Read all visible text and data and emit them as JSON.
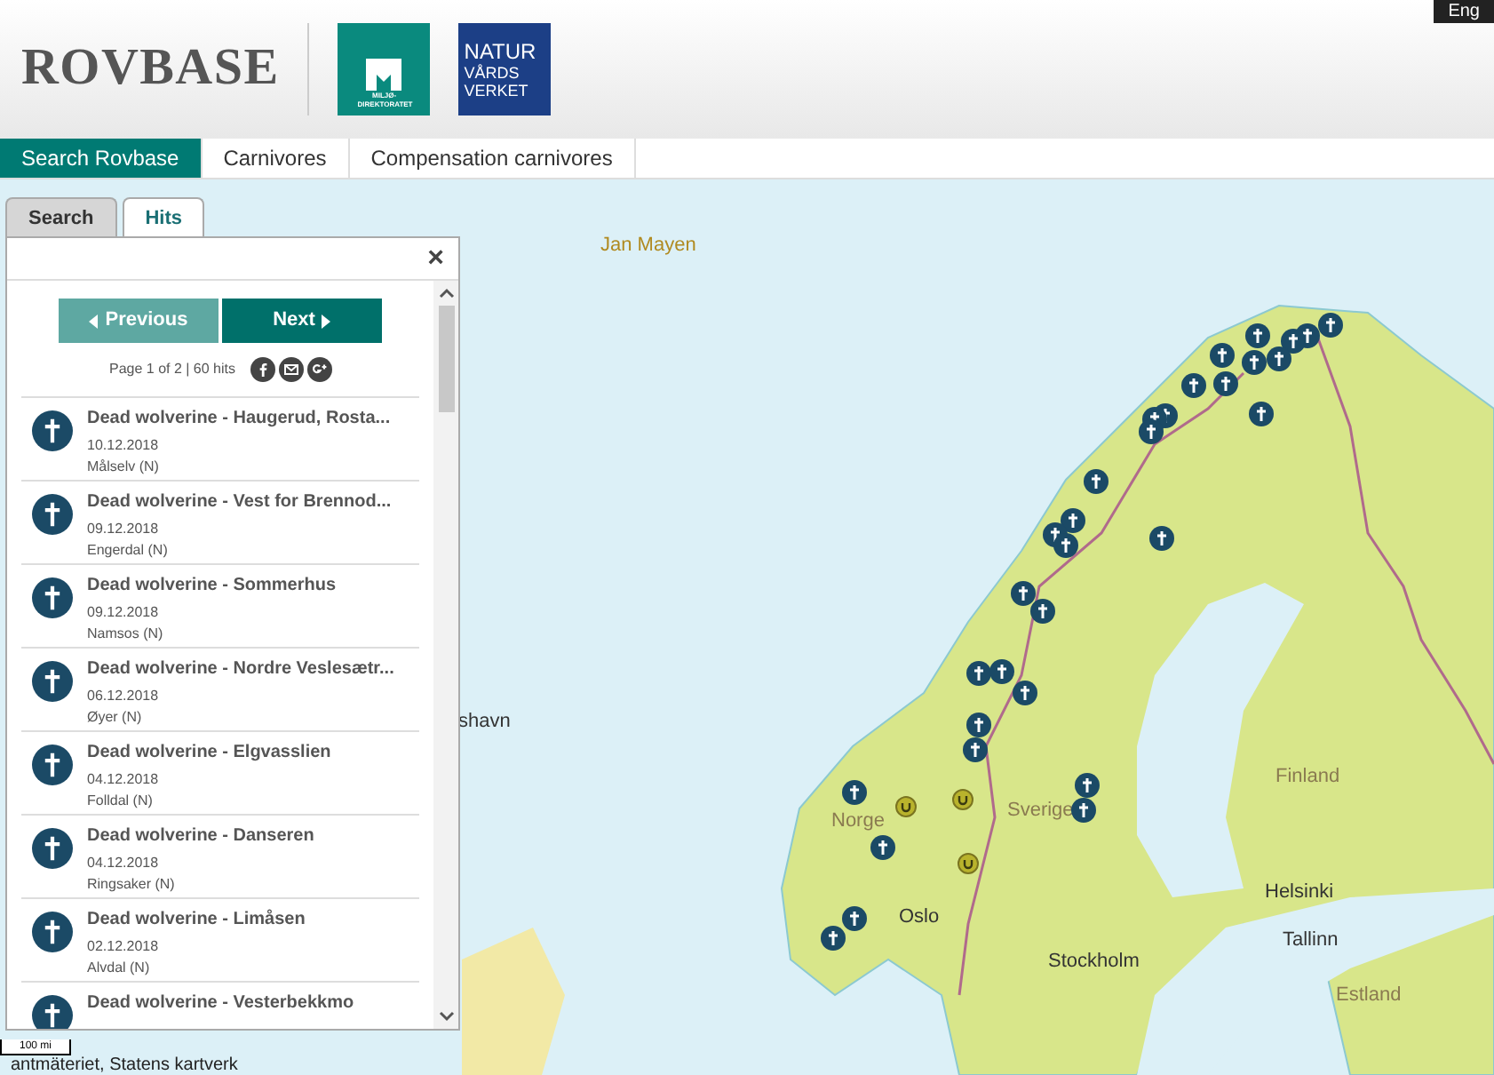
{
  "header": {
    "logo": "ROVBASE",
    "agency_logo_1": "MILJØ-DIREKTORATET",
    "agency_logo_2": [
      "NATUR",
      "VÅRDS",
      "VERKET"
    ],
    "language_button": "Eng"
  },
  "nav": [
    {
      "label": "Search Rovbase",
      "selected": true
    },
    {
      "label": "Carnivores",
      "selected": false
    },
    {
      "label": "Compensation carnivores",
      "selected": false
    }
  ],
  "panel_tabs": [
    {
      "label": "Search",
      "selected": false
    },
    {
      "label": "Hits",
      "selected": true
    }
  ],
  "panel": {
    "close": "×",
    "previous": "Previous",
    "next": "Next",
    "paging": "Page 1 of 2 | 60 hits",
    "hits": [
      {
        "title": "Dead wolverine - Haugerud, Rosta...",
        "date": "10.12.2018",
        "place": "Målselv (N)"
      },
      {
        "title": "Dead wolverine - Vest for Brennod...",
        "date": "09.12.2018",
        "place": "Engerdal (N)"
      },
      {
        "title": "Dead wolverine - Sommerhus",
        "date": "09.12.2018",
        "place": "Namsos (N)"
      },
      {
        "title": "Dead wolverine - Nordre Veslesætr...",
        "date": "06.12.2018",
        "place": "Øyer (N)"
      },
      {
        "title": "Dead wolverine - Elgvasslien",
        "date": "04.12.2018",
        "place": "Folldal (N)"
      },
      {
        "title": "Dead wolverine - Danseren",
        "date": "04.12.2018",
        "place": "Ringsaker (N)"
      },
      {
        "title": "Dead wolverine - Limåsen",
        "date": "02.12.2018",
        "place": "Alvdal (N)"
      },
      {
        "title": "Dead wolverine - Vesterbekkmo"
      }
    ]
  },
  "map": {
    "labels": [
      {
        "text": "Jan Mayen",
        "kind": "island"
      },
      {
        "text": "shavn",
        "kind": "city"
      },
      {
        "text": "Norge",
        "kind": "country"
      },
      {
        "text": "Sverige",
        "kind": "country"
      },
      {
        "text": "Finland",
        "kind": "country"
      },
      {
        "text": "Oslo",
        "kind": "city"
      },
      {
        "text": "Helsinki",
        "kind": "city"
      },
      {
        "text": "Tallinn",
        "kind": "city"
      },
      {
        "text": "Stockholm",
        "kind": "city"
      },
      {
        "text": "Estland",
        "kind": "country"
      }
    ],
    "scale": "100 mi",
    "attribution": "antmäteriet, Statens kartverk"
  }
}
